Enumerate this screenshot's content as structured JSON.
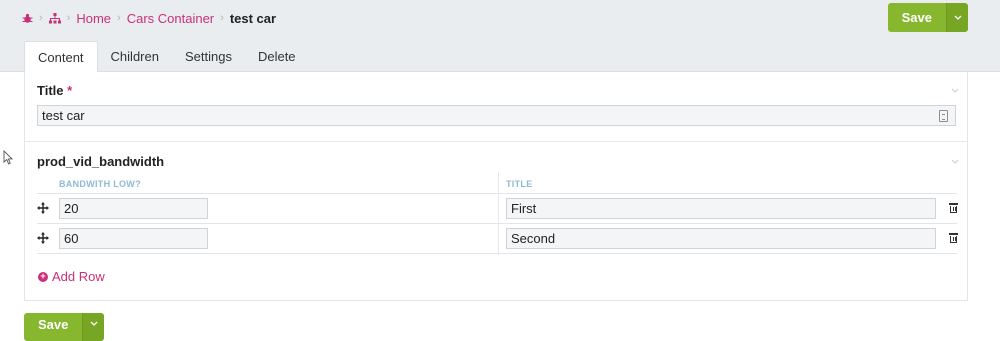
{
  "breadcrumb": {
    "home_icon": "bug-icon",
    "tree_icon": "sitemap-icon",
    "items": [
      "Home",
      "Cars Container"
    ],
    "current": "test car"
  },
  "toolbar": {
    "save_label": "Save",
    "caret_icon": "chevron-down-icon"
  },
  "tabs": [
    {
      "label": "Content",
      "active": true
    },
    {
      "label": "Children",
      "active": false
    },
    {
      "label": "Settings",
      "active": false
    },
    {
      "label": "Delete",
      "active": false
    }
  ],
  "form": {
    "title_label": "Title",
    "required_mark": "*",
    "title_value": "test car",
    "grid_label": "prod_vid_bandwidth",
    "columns": [
      "BANDWITH LOW?",
      "TITLE"
    ],
    "rows": [
      {
        "bandwidth": "20",
        "title": "First"
      },
      {
        "bandwidth": "60",
        "title": "Second"
      }
    ],
    "add_row_label": "Add Row"
  },
  "colors": {
    "accent": "#c8317a",
    "save": "#86b72e",
    "header_bg": "#eaedef",
    "column_head": "#8fbad3"
  }
}
